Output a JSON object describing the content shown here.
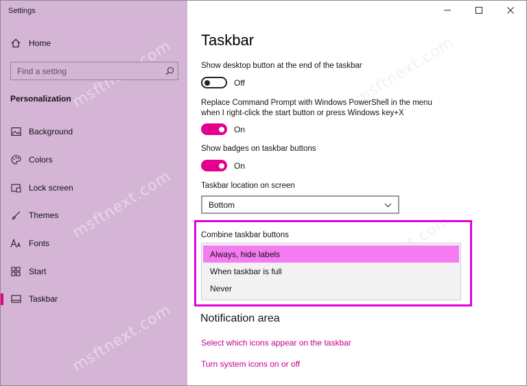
{
  "window": {
    "title": "Settings",
    "minimize_icon": "minimize-icon",
    "maximize_icon": "maximize-icon",
    "close_icon": "close-icon"
  },
  "sidebar": {
    "home": {
      "label": "Home",
      "icon": "home-icon"
    },
    "search": {
      "placeholder": "Find a setting",
      "icon": "search-icon"
    },
    "section_title": "Personalization",
    "items": [
      {
        "label": "Background",
        "icon": "picture-icon"
      },
      {
        "label": "Colors",
        "icon": "palette-icon"
      },
      {
        "label": "Lock screen",
        "icon": "lock-screen-icon"
      },
      {
        "label": "Themes",
        "icon": "brush-icon"
      },
      {
        "label": "Fonts",
        "icon": "font-icon"
      },
      {
        "label": "Start",
        "icon": "start-icon"
      },
      {
        "label": "Taskbar",
        "icon": "taskbar-icon",
        "active": true
      }
    ],
    "accent_color": "#e3008c"
  },
  "main": {
    "title": "Taskbar",
    "settings": [
      {
        "label": "Show desktop button at the end of the taskbar",
        "state": "Off",
        "on": false
      },
      {
        "label_line1": "Replace Command Prompt with Windows PowerShell in the menu",
        "label_line2": "when I right-click the start button or press Windows key+X",
        "state": "On",
        "on": true
      },
      {
        "label": "Show badges on taskbar buttons",
        "state": "On",
        "on": true
      }
    ],
    "location": {
      "label": "Taskbar location on screen",
      "value": "Bottom"
    },
    "combine": {
      "label": "Combine taskbar buttons",
      "options": [
        "Always, hide labels",
        "When taskbar is full",
        "Never"
      ],
      "selected": "Always, hide labels"
    },
    "notification": {
      "heading": "Notification area",
      "links": [
        "Select which icons appear on the taskbar",
        "Turn system icons on or off"
      ]
    }
  },
  "watermark": "msftnext.com"
}
